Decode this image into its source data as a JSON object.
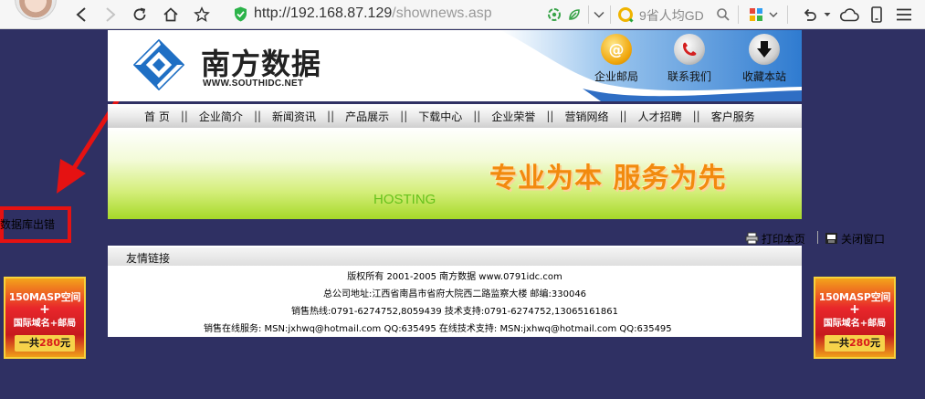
{
  "browser": {
    "url_host": "http://192.168.87.129",
    "url_path": "/shownews.asp",
    "search_text": "9省人均GD"
  },
  "site": {
    "logo_cn": "南方数据",
    "logo_en": "WWW.SOUTHIDC.NET",
    "header_links": [
      {
        "label": "企业邮局",
        "icon": "email-icon"
      },
      {
        "label": "联系我们",
        "icon": "contact-icon"
      },
      {
        "label": "收藏本站",
        "icon": "bookmark-icon"
      }
    ],
    "nav": [
      "首 页",
      "企业简介",
      "新闻资讯",
      "产品展示",
      "下载中心",
      "企业荣誉",
      "营销网络",
      "人才招聘",
      "客户服务"
    ],
    "nav_separator": "||",
    "banner_slogan": "专业为本 服务为先",
    "banner_hosting": "HOSTING",
    "print_label": "打印本页",
    "close_label": "关闭窗口",
    "friend_links_title": "友情链接",
    "footer_lines": [
      "版权所有 2001-2005 南方数据 www.0791idc.com",
      "总公司地址:江西省南昌市省府大院西二路监察大楼 邮编:330046",
      "销售热线:0791-6274752,8059439 技术支持:0791-6274752,13065161861",
      "销售在线服务: MSN:jxhwq@hotmail.com QQ:635495 在线技术支持: MSN:jxhwq@hotmail.com QQ:635495"
    ]
  },
  "db_error": "数据库出错",
  "ad": {
    "line1": "150MASP空间",
    "line2": "+",
    "line3": "国际域名+邮局",
    "line4_prefix": "一共",
    "line4_price": "280",
    "line4_suffix": "元"
  }
}
